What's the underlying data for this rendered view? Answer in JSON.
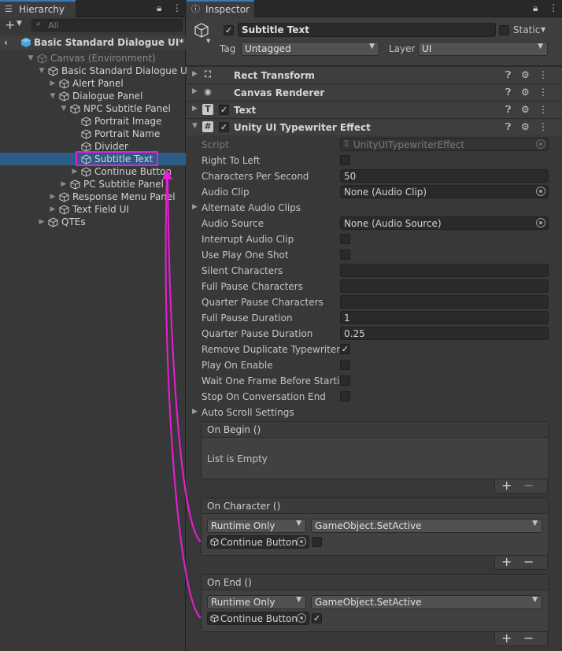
{
  "hierarchy": {
    "tab_title": "Hierarchy",
    "add_label": "+",
    "search_placeholder": "All",
    "scene": "Basic Standard Dialogue UI*",
    "items": [
      {
        "label": "Canvas (Environment)",
        "muted": true
      },
      {
        "label": "Basic Standard Dialogue UI"
      },
      {
        "label": "Alert Panel"
      },
      {
        "label": "Dialogue Panel"
      },
      {
        "label": "NPC Subtitle Panel"
      },
      {
        "label": "Portrait Image"
      },
      {
        "label": "Portrait Name"
      },
      {
        "label": "Divider"
      },
      {
        "label": "Subtitle Text",
        "selected": true
      },
      {
        "label": "Continue Button"
      },
      {
        "label": "PC Subtitle Panel"
      },
      {
        "label": "Response Menu Panel"
      },
      {
        "label": "Text Field UI"
      },
      {
        "label": "QTEs"
      }
    ]
  },
  "inspector": {
    "tab_title": "Inspector",
    "object_name": "Subtitle Text",
    "static_label": "Static",
    "tag_label": "Tag",
    "tag_value": "Untagged",
    "layer_label": "Layer",
    "layer_value": "UI",
    "components": [
      {
        "name": "Rect Transform",
        "icon": "rect-transform-icon"
      },
      {
        "name": "Canvas Renderer",
        "icon": "eye-icon"
      },
      {
        "name": "Text",
        "icon": "text-t-icon"
      },
      {
        "name": "Unity UI Typewriter Effect",
        "icon": "script-hash-icon"
      }
    ],
    "typewriter": {
      "script_label": "Script",
      "script_value": "UnityUITypewriterEffect",
      "right_to_left": "Right To Left",
      "cps_label": "Characters Per Second",
      "cps_value": "50",
      "audio_clip_label": "Audio Clip",
      "audio_clip_value": "None (Audio Clip)",
      "alt_audio_label": "Alternate Audio Clips",
      "audio_source_label": "Audio Source",
      "audio_source_value": "None (Audio Source)",
      "interrupt_label": "Interrupt Audio Clip",
      "play_one_shot_label": "Use Play One Shot",
      "silent_label": "Silent Characters",
      "full_pause_chars_label": "Full Pause Characters",
      "quarter_pause_chars_label": "Quarter Pause Characters",
      "full_pause_dur_label": "Full Pause Duration",
      "full_pause_dur_value": "1",
      "quarter_pause_dur_label": "Quarter Pause Duration",
      "quarter_pause_dur_value": "0.25",
      "remove_dup_label": "Remove Duplicate Typewriter Effects",
      "play_on_enable_label": "Play On Enable",
      "wait_frame_label": "Wait One Frame Before Starting",
      "stop_on_end_label": "Stop On Conversation End",
      "auto_scroll_label": "Auto Scroll Settings"
    },
    "events": {
      "on_begin": {
        "title": "On Begin ()",
        "empty": "List is Empty"
      },
      "on_character": {
        "title": "On Character ()",
        "mode": "Runtime Only",
        "function": "GameObject.SetActive",
        "target": "Continue Button",
        "checked": false
      },
      "on_end": {
        "title": "On End ()",
        "mode": "Runtime Only",
        "function": "GameObject.SetActive",
        "target": "Continue Button",
        "checked": true
      },
      "plus": "+",
      "minus": "−"
    }
  },
  "annotation_color": "#e81ed6"
}
